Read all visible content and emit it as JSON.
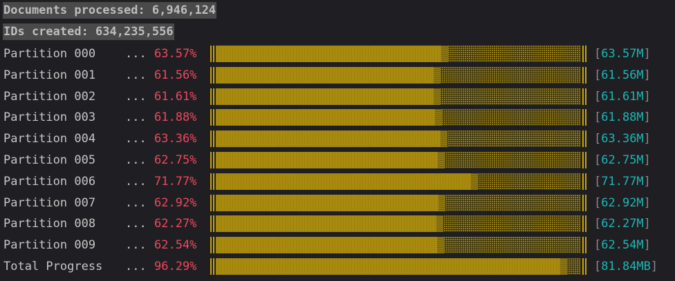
{
  "header": {
    "documents_processed": "Documents processed: 6,946,124",
    "ids_created": "IDs created: 634,235,556"
  },
  "colors": {
    "background": "#1f1f23",
    "percent_text": "#f0475f",
    "bar_fill": "#a88b0e",
    "bar_track": "#3a3413",
    "count_text": "#1bb7b5"
  },
  "separator": "...",
  "rows": [
    {
      "label": "Partition 000",
      "percent": "63.57%",
      "fraction": 0.6357,
      "count": "63.57M"
    },
    {
      "label": "Partition 001",
      "percent": "61.56%",
      "fraction": 0.6156,
      "count": "61.56M"
    },
    {
      "label": "Partition 002",
      "percent": "61.61%",
      "fraction": 0.6161,
      "count": "61.61M"
    },
    {
      "label": "Partition 003",
      "percent": "61.88%",
      "fraction": 0.6188,
      "count": "61.88M"
    },
    {
      "label": "Partition 004",
      "percent": "63.36%",
      "fraction": 0.6336,
      "count": "63.36M"
    },
    {
      "label": "Partition 005",
      "percent": "62.75%",
      "fraction": 0.6275,
      "count": "62.75M"
    },
    {
      "label": "Partition 006",
      "percent": "71.77%",
      "fraction": 0.7177,
      "count": "71.77M"
    },
    {
      "label": "Partition 007",
      "percent": "62.92%",
      "fraction": 0.6292,
      "count": "62.92M"
    },
    {
      "label": "Partition 008",
      "percent": "62.27%",
      "fraction": 0.6227,
      "count": "62.27M"
    },
    {
      "label": "Partition 009",
      "percent": "62.54%",
      "fraction": 0.6254,
      "count": "62.54M"
    },
    {
      "label": "Total Progress",
      "percent": "96.29%",
      "fraction": 0.9629,
      "count": "81.84MB"
    }
  ]
}
